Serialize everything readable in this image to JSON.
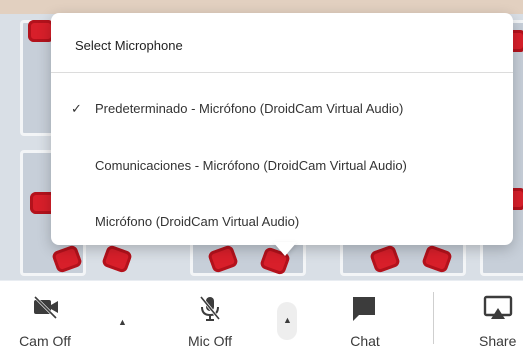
{
  "popup": {
    "title": "Select Microphone",
    "selected_mark": "✓",
    "options": [
      {
        "label": "Predeterminado - Micrófono (DroidCam Virtual Audio)",
        "selected": true
      },
      {
        "label": "Comunicaciones - Micrófono (DroidCam Virtual Audio)",
        "selected": false
      },
      {
        "label": "Micrófono (DroidCam Virtual Audio)",
        "selected": false
      }
    ]
  },
  "toolbar": {
    "cam_label": "Cam Off",
    "mic_label": "Mic Off",
    "chat_label": "Chat",
    "share_label": "Share",
    "caret_glyph": "▲"
  },
  "colors": {
    "chair_red": "#d81f2a",
    "popup_bg": "#ffffff",
    "toolbar_bg": "#ffffff",
    "icon_dark": "#3c3c3c"
  },
  "icons": [
    "camera-off-icon",
    "microphone-off-icon",
    "chat-icon",
    "share-screen-icon",
    "caret-up-icon",
    "checkmark-icon"
  ]
}
